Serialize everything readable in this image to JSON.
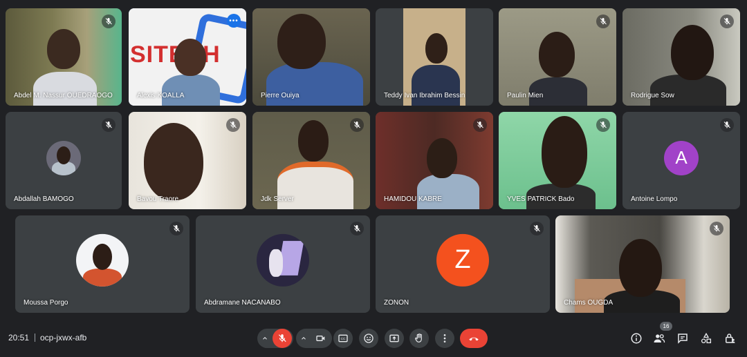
{
  "participants": [
    {
      "name": "Abdel M. Nassur OUEDRAOGO"
    },
    {
      "name": "Alexis KOALLA",
      "banner": "SITECH"
    },
    {
      "name": "Pierre Ouiya"
    },
    {
      "name": "Teddy Ivan Ibrahim Bessin"
    },
    {
      "name": "Paulin Mien"
    },
    {
      "name": "Rodrigue Sow"
    },
    {
      "name": "Abdallah BAMOGO"
    },
    {
      "name": "Bavou Traore"
    },
    {
      "name": "Jdk Server"
    },
    {
      "name": "HAMIDOU KABRE"
    },
    {
      "name": "YVES PATRICK Bado"
    },
    {
      "name": "Antoine Lompo",
      "initial": "A",
      "color": "#a142c8"
    },
    {
      "name": "Moussa Porgo"
    },
    {
      "name": "Abdramane NACANABO"
    },
    {
      "name": "ZONON",
      "initial": "Z",
      "color": "#f4511e"
    },
    {
      "name": "Chams OUGDA"
    }
  ],
  "bar": {
    "time": "20:51",
    "meeting_code": "ocp-jxwx-afb",
    "participant_count": "16"
  },
  "colors": {
    "background": "#202124",
    "tile": "#3c4043",
    "hangup_red": "#ea4335",
    "active_outline": "#8ab4f8"
  }
}
